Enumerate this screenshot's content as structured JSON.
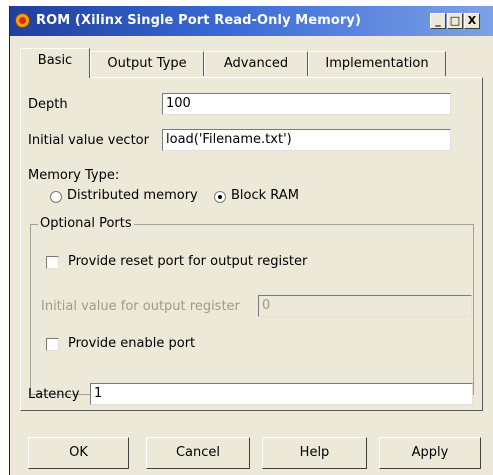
{
  "window": {
    "title": "ROM (Xilinx Single Port Read-Only Memory)",
    "title_buttons": {
      "minimize": "_",
      "maximize": "□",
      "close": "X"
    }
  },
  "tabs": [
    {
      "label": "Basic",
      "active": true
    },
    {
      "label": "Output Type",
      "active": false
    },
    {
      "label": "Advanced",
      "active": false
    },
    {
      "label": "Implementation",
      "active": false
    }
  ],
  "basic": {
    "depth": {
      "label": "Depth",
      "value": "100"
    },
    "initial_value_vector": {
      "label": "Initial value vector",
      "value": "load('Filename.txt')"
    },
    "memory_type": {
      "label": "Memory Type:",
      "options": [
        {
          "label": "Distributed memory",
          "selected": false
        },
        {
          "label": "Block RAM",
          "selected": true
        }
      ]
    },
    "optional_ports": {
      "title": "Optional Ports",
      "reset_port": {
        "label": "Provide reset port for output register",
        "checked": false
      },
      "initial_output": {
        "label": "Initial value for output register",
        "value": "0",
        "enabled": false
      },
      "enable_port": {
        "label": "Provide enable port",
        "checked": false
      }
    },
    "latency": {
      "label": "Latency",
      "value": "1"
    }
  },
  "buttons": {
    "ok": "OK",
    "cancel": "Cancel",
    "help": "Help",
    "apply": "Apply"
  },
  "colors": {
    "titlebar_start": "#1f3f9b",
    "titlebar_end": "#7ea2e6",
    "dialog_bg": "#ece9d8"
  }
}
